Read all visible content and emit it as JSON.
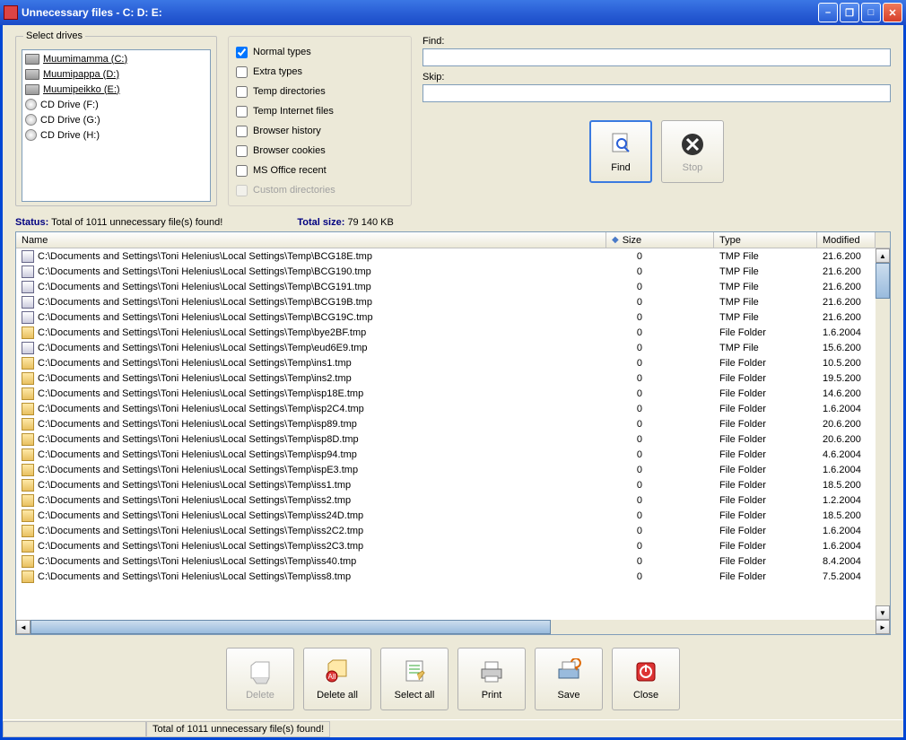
{
  "window": {
    "title": "Unnecessary files - C: D: E:"
  },
  "drives": {
    "legend": "Select drives",
    "items": [
      {
        "label": "Muumimamma (C:)",
        "type": "hdd",
        "selected": true
      },
      {
        "label": "Muumipappa (D:)",
        "type": "hdd",
        "selected": true
      },
      {
        "label": "Muumipeikko (E:)",
        "type": "hdd",
        "selected": true
      },
      {
        "label": "CD Drive (F:)",
        "type": "cd",
        "selected": false
      },
      {
        "label": "CD Drive (G:)",
        "type": "cd",
        "selected": false
      },
      {
        "label": "CD Drive (H:)",
        "type": "cd",
        "selected": false
      }
    ]
  },
  "checks": [
    {
      "label": "Normal types",
      "checked": true,
      "enabled": true
    },
    {
      "label": "Extra types",
      "checked": false,
      "enabled": true
    },
    {
      "label": "Temp directories",
      "checked": false,
      "enabled": true
    },
    {
      "label": "Temp Internet files",
      "checked": false,
      "enabled": true
    },
    {
      "label": "Browser history",
      "checked": false,
      "enabled": true
    },
    {
      "label": "Browser cookies",
      "checked": false,
      "enabled": true
    },
    {
      "label": "MS Office recent",
      "checked": false,
      "enabled": true
    },
    {
      "label": "Custom directories",
      "checked": false,
      "enabled": false
    }
  ],
  "find": {
    "find_label": "Find:",
    "skip_label": "Skip:",
    "find_value": "",
    "skip_value": "",
    "find_btn": "Find",
    "stop_btn": "Stop"
  },
  "status": {
    "label": "Status:",
    "text": "Total of 1011 unnecessary file(s) found!",
    "size_label": "Total size:",
    "size_value": "79 140 KB"
  },
  "columns": {
    "name": "Name",
    "size": "Size",
    "type": "Type",
    "modified": "Modified"
  },
  "files": [
    {
      "name": "C:\\Documents and Settings\\Toni Helenius\\Local Settings\\Temp\\BCG18E.tmp",
      "size": "0",
      "type": "TMP File",
      "modified": "21.6.200",
      "icon": "tmp"
    },
    {
      "name": "C:\\Documents and Settings\\Toni Helenius\\Local Settings\\Temp\\BCG190.tmp",
      "size": "0",
      "type": "TMP File",
      "modified": "21.6.200",
      "icon": "tmp"
    },
    {
      "name": "C:\\Documents and Settings\\Toni Helenius\\Local Settings\\Temp\\BCG191.tmp",
      "size": "0",
      "type": "TMP File",
      "modified": "21.6.200",
      "icon": "tmp"
    },
    {
      "name": "C:\\Documents and Settings\\Toni Helenius\\Local Settings\\Temp\\BCG19B.tmp",
      "size": "0",
      "type": "TMP File",
      "modified": "21.6.200",
      "icon": "tmp"
    },
    {
      "name": "C:\\Documents and Settings\\Toni Helenius\\Local Settings\\Temp\\BCG19C.tmp",
      "size": "0",
      "type": "TMP File",
      "modified": "21.6.200",
      "icon": "tmp"
    },
    {
      "name": "C:\\Documents and Settings\\Toni Helenius\\Local Settings\\Temp\\bye2BF.tmp",
      "size": "0",
      "type": "File Folder",
      "modified": "1.6.2004",
      "icon": "folder"
    },
    {
      "name": "C:\\Documents and Settings\\Toni Helenius\\Local Settings\\Temp\\eud6E9.tmp",
      "size": "0",
      "type": "TMP File",
      "modified": "15.6.200",
      "icon": "tmp"
    },
    {
      "name": "C:\\Documents and Settings\\Toni Helenius\\Local Settings\\Temp\\ins1.tmp",
      "size": "0",
      "type": "File Folder",
      "modified": "10.5.200",
      "icon": "folder"
    },
    {
      "name": "C:\\Documents and Settings\\Toni Helenius\\Local Settings\\Temp\\ins2.tmp",
      "size": "0",
      "type": "File Folder",
      "modified": "19.5.200",
      "icon": "folder"
    },
    {
      "name": "C:\\Documents and Settings\\Toni Helenius\\Local Settings\\Temp\\isp18E.tmp",
      "size": "0",
      "type": "File Folder",
      "modified": "14.6.200",
      "icon": "folder"
    },
    {
      "name": "C:\\Documents and Settings\\Toni Helenius\\Local Settings\\Temp\\isp2C4.tmp",
      "size": "0",
      "type": "File Folder",
      "modified": "1.6.2004",
      "icon": "folder"
    },
    {
      "name": "C:\\Documents and Settings\\Toni Helenius\\Local Settings\\Temp\\isp89.tmp",
      "size": "0",
      "type": "File Folder",
      "modified": "20.6.200",
      "icon": "folder"
    },
    {
      "name": "C:\\Documents and Settings\\Toni Helenius\\Local Settings\\Temp\\isp8D.tmp",
      "size": "0",
      "type": "File Folder",
      "modified": "20.6.200",
      "icon": "folder"
    },
    {
      "name": "C:\\Documents and Settings\\Toni Helenius\\Local Settings\\Temp\\isp94.tmp",
      "size": "0",
      "type": "File Folder",
      "modified": "4.6.2004",
      "icon": "folder"
    },
    {
      "name": "C:\\Documents and Settings\\Toni Helenius\\Local Settings\\Temp\\ispE3.tmp",
      "size": "0",
      "type": "File Folder",
      "modified": "1.6.2004",
      "icon": "folder"
    },
    {
      "name": "C:\\Documents and Settings\\Toni Helenius\\Local Settings\\Temp\\iss1.tmp",
      "size": "0",
      "type": "File Folder",
      "modified": "18.5.200",
      "icon": "folder"
    },
    {
      "name": "C:\\Documents and Settings\\Toni Helenius\\Local Settings\\Temp\\iss2.tmp",
      "size": "0",
      "type": "File Folder",
      "modified": "1.2.2004",
      "icon": "folder"
    },
    {
      "name": "C:\\Documents and Settings\\Toni Helenius\\Local Settings\\Temp\\iss24D.tmp",
      "size": "0",
      "type": "File Folder",
      "modified": "18.5.200",
      "icon": "folder"
    },
    {
      "name": "C:\\Documents and Settings\\Toni Helenius\\Local Settings\\Temp\\iss2C2.tmp",
      "size": "0",
      "type": "File Folder",
      "modified": "1.6.2004",
      "icon": "folder"
    },
    {
      "name": "C:\\Documents and Settings\\Toni Helenius\\Local Settings\\Temp\\iss2C3.tmp",
      "size": "0",
      "type": "File Folder",
      "modified": "1.6.2004",
      "icon": "folder"
    },
    {
      "name": "C:\\Documents and Settings\\Toni Helenius\\Local Settings\\Temp\\iss40.tmp",
      "size": "0",
      "type": "File Folder",
      "modified": "8.4.2004",
      "icon": "folder"
    },
    {
      "name": "C:\\Documents and Settings\\Toni Helenius\\Local Settings\\Temp\\iss8.tmp",
      "size": "0",
      "type": "File Folder",
      "modified": "7.5.2004",
      "icon": "folder"
    }
  ],
  "buttons": {
    "delete": "Delete",
    "delete_all": "Delete all",
    "select_all": "Select all",
    "print": "Print",
    "save": "Save",
    "close": "Close"
  },
  "statusbar": {
    "text": "Total of 1011 unnecessary file(s) found!"
  }
}
